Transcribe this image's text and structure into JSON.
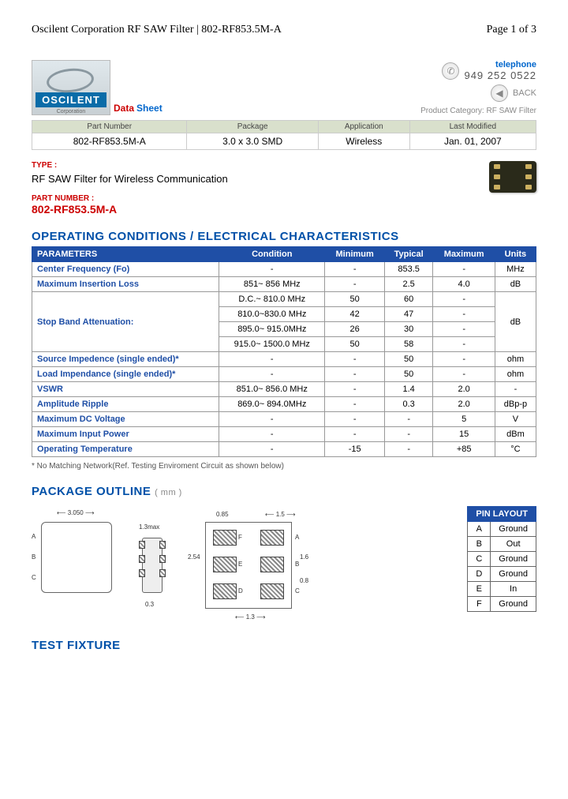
{
  "header": {
    "title": "Oscilent Corporation RF SAW Filter | 802-RF853.5M-A",
    "page": "Page 1 of 3"
  },
  "logo": {
    "brand": "OSCILENT",
    "sub": "Corporation"
  },
  "data_sheet": {
    "red": "Data",
    "blue": "Sheet"
  },
  "contact": {
    "tel_label": "telephone",
    "tel": "949 252 0522",
    "back": "BACK",
    "category": "Product Category: RF SAW Filter"
  },
  "meta": {
    "headers": [
      "Part Number",
      "Package",
      "Application",
      "Last Modified"
    ],
    "values": [
      "802-RF853.5M-A",
      "3.0 x 3.0 SMD",
      "Wireless",
      "Jan. 01, 2007"
    ]
  },
  "type": {
    "label": "TYPE :",
    "text": "RF SAW Filter for Wireless Communication"
  },
  "pn": {
    "label": "PART NUMBER :",
    "value": "802-RF853.5M-A"
  },
  "sections": {
    "opcond": "OPERATING CONDITIONS / ELECTRICAL CHARACTERISTICS",
    "outline": "PACKAGE OUTLINE",
    "outline_unit": "( mm )",
    "fixture": "TEST FIXTURE"
  },
  "spec": {
    "headers": [
      "PARAMETERS",
      "Condition",
      "Minimum",
      "Typical",
      "Maximum",
      "Units"
    ],
    "rows": [
      {
        "param": "Center Frequency (Fo)",
        "cond": "-",
        "min": "-",
        "typ": "853.5",
        "max": "-",
        "unit": "MHz"
      },
      {
        "param": "Maximum Insertion Loss",
        "cond": "851~ 856 MHz",
        "min": "-",
        "typ": "2.5",
        "max": "4.0",
        "unit": "dB"
      },
      {
        "param": "Stop Band Attenuation:",
        "cond": "D.C.~ 810.0 MHz",
        "min": "50",
        "typ": "60",
        "max": "-",
        "unit": "dB",
        "rowspan_param": 4,
        "rowspan_unit": 4
      },
      {
        "cond": "810.0~830.0 MHz",
        "min": "42",
        "typ": "47",
        "max": "-"
      },
      {
        "cond": "895.0~ 915.0MHz",
        "min": "26",
        "typ": "30",
        "max": "-"
      },
      {
        "cond": "915.0~ 1500.0 MHz",
        "min": "50",
        "typ": "58",
        "max": "-"
      },
      {
        "param": "Source Impedence (single ended)*",
        "cond": "-",
        "min": "-",
        "typ": "50",
        "max": "-",
        "unit": "ohm"
      },
      {
        "param": "Load Impendance (single ended)*",
        "cond": "-",
        "min": "-",
        "typ": "50",
        "max": "-",
        "unit": "ohm"
      },
      {
        "param": "VSWR",
        "cond": "851.0~ 856.0 MHz",
        "min": "-",
        "typ": "1.4",
        "max": "2.0",
        "unit": "-"
      },
      {
        "param": "Amplitude Ripple",
        "cond": "869.0~ 894.0MHz",
        "min": "-",
        "typ": "0.3",
        "max": "2.0",
        "unit": "dBp-p"
      },
      {
        "param": "Maximum DC Voltage",
        "cond": "-",
        "min": "-",
        "typ": "-",
        "max": "5",
        "unit": "V"
      },
      {
        "param": "Maximum Input Power",
        "cond": "-",
        "min": "-",
        "typ": "-",
        "max": "15",
        "unit": "dBm"
      },
      {
        "param": "Operating Temperature",
        "cond": "-",
        "min": "-15",
        "typ": "-",
        "max": "+85",
        "unit": "°C"
      }
    ]
  },
  "footnote": "* No Matching Network(Ref. Testing Enviroment Circuit as shown below)",
  "pins": {
    "header": "PIN LAYOUT",
    "rows": [
      [
        "A",
        "Ground"
      ],
      [
        "B",
        "Out"
      ],
      [
        "C",
        "Ground"
      ],
      [
        "D",
        "Ground"
      ],
      [
        "E",
        "In"
      ],
      [
        "F",
        "Ground"
      ]
    ]
  },
  "dims": {
    "w": "3.050",
    "t": "1.3max",
    "ph": "0.85",
    "pw": "1.5",
    "ih": "2.54",
    "ie": "1.6",
    "gc": "0.8",
    "bot": "0.3",
    "botw": "1.3"
  },
  "pinlabels": {
    "A": "A",
    "B": "B",
    "C": "C",
    "D": "D",
    "E": "E",
    "F": "F"
  }
}
